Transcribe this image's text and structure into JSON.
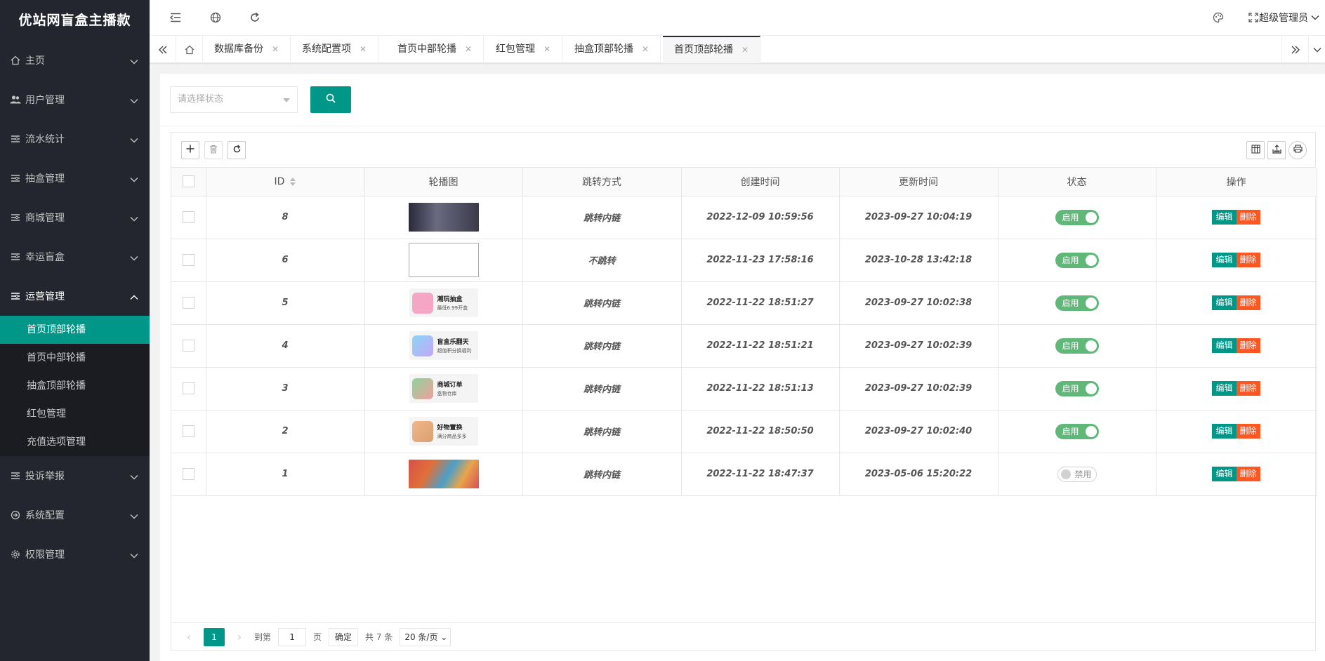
{
  "app_title": "优站网盲盒主播款",
  "sidebar": {
    "items": [
      {
        "label": "主页",
        "icon": "home-icon"
      },
      {
        "label": "用户管理",
        "icon": "users-icon"
      },
      {
        "label": "流水统计",
        "icon": "list-icon"
      },
      {
        "label": "抽盒管理",
        "icon": "list-icon"
      },
      {
        "label": "商城管理",
        "icon": "list-icon"
      },
      {
        "label": "幸运盲盒",
        "icon": "list-icon"
      },
      {
        "label": "运营管理",
        "icon": "list-icon"
      },
      {
        "label": "投诉举报",
        "icon": "list-icon"
      },
      {
        "label": "系统配置",
        "icon": "config-icon"
      },
      {
        "label": "权限管理",
        "icon": "gear-icon"
      }
    ],
    "sub_items": [
      "首页顶部轮播",
      "首页中部轮播",
      "抽盒顶部轮播",
      "红包管理",
      "充值选项管理"
    ]
  },
  "header": {
    "user": "超级管理员"
  },
  "tabs": [
    "数据库备份",
    "系统配置项",
    "首页中部轮播",
    "红包管理",
    "抽盒顶部轮播",
    "首页顶部轮播"
  ],
  "search": {
    "placeholder": "请选择状态"
  },
  "table": {
    "headers": [
      "ID",
      "轮播图",
      "跳转方式",
      "创建时间",
      "更新时间",
      "状态",
      "操作"
    ],
    "rows": [
      {
        "id": "8",
        "jump": "跳转内链",
        "created": "2022-12-09 10:59:56",
        "updated": "2023-09-27 10:04:19",
        "status": "启用"
      },
      {
        "id": "6",
        "jump": "不跳转",
        "created": "2022-11-23 17:58:16",
        "updated": "2023-10-28 13:42:18",
        "status": "启用"
      },
      {
        "id": "5",
        "jump": "跳转内链",
        "created": "2022-11-22 18:51:27",
        "updated": "2023-09-27 10:02:38",
        "status": "启用",
        "card_title": "潮玩抽盒",
        "card_sub": "最低6.99开盒"
      },
      {
        "id": "4",
        "jump": "跳转内链",
        "created": "2022-11-22 18:51:21",
        "updated": "2023-09-27 10:02:39",
        "status": "启用",
        "card_title": "盲盒乐翻天",
        "card_sub": "超值积分换福利"
      },
      {
        "id": "3",
        "jump": "跳转内链",
        "created": "2022-11-22 18:51:13",
        "updated": "2023-09-27 10:02:39",
        "status": "启用",
        "card_title": "商城订单",
        "card_sub": "盒物仓库"
      },
      {
        "id": "2",
        "jump": "跳转内链",
        "created": "2022-11-22 18:50:50",
        "updated": "2023-09-27 10:02:40",
        "status": "启用",
        "card_title": "好物置换",
        "card_sub": "满分商品多多"
      },
      {
        "id": "1",
        "jump": "跳转内链",
        "created": "2022-11-22 18:47:37",
        "updated": "2023-05-06 15:20:22",
        "status": "禁用"
      }
    ],
    "edit_label": "编辑",
    "delete_label": "删除"
  },
  "pager": {
    "current": "1",
    "goto": "到第",
    "page_input": "1",
    "page_unit": "页",
    "confirm": "确定",
    "total": "共 7 条",
    "per_page": "20 条/页"
  },
  "colors": {
    "accent": "#009688",
    "sidebar_bg": "#23262e",
    "danger": "#ff5722",
    "switch_on": "#5fb878"
  }
}
